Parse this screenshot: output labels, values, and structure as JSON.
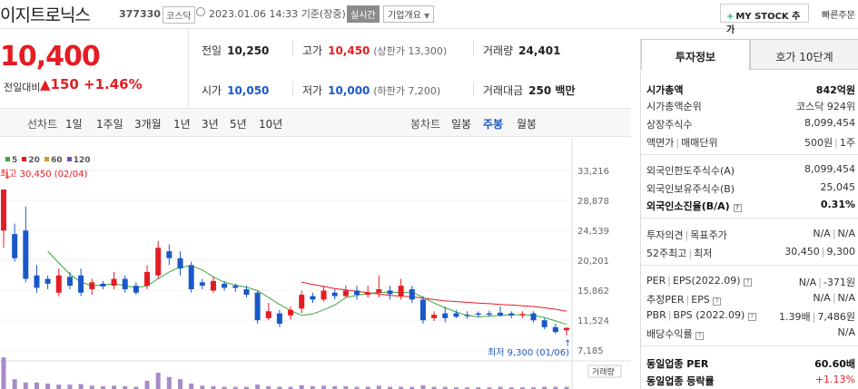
{
  "header": {
    "name": "이지트로닉스",
    "code": "377330",
    "market_badge": "코스닥",
    "datetime": "2023.01.06 14:33",
    "basis": "기준(장중)",
    "realtime_button": "실시간",
    "company_overview": "기업개요",
    "my_stock_button": "MY STOCK 추가",
    "fast_label": "빠른주문"
  },
  "price": {
    "current": "10,400",
    "change_label": "전일대비",
    "change": "▲150",
    "change_pct": "+1.46%"
  },
  "quote": {
    "prev_close_label": "전일",
    "prev_close": "10,250",
    "high_label": "고가",
    "high": "10,450",
    "upper_limit": "(상한가 13,300)",
    "volume_label": "거래량",
    "volume": "24,401",
    "open_label": "시가",
    "open": "10,050",
    "low_label": "저가",
    "low": "10,000",
    "lower_limit": "(하한가 7,200)",
    "amount_label": "거래대금",
    "amount": "250 백만"
  },
  "toolbar": {
    "line_chart_label": "선차트",
    "periods": [
      "1일",
      "1주일",
      "3개월",
      "1년",
      "3년",
      "5년",
      "10년"
    ],
    "candle_chart_label": "봉차트",
    "candle_periods": [
      "일봉",
      "주봉",
      "월봉"
    ],
    "active_candle": "주봉"
  },
  "chart": {
    "ma_legend": [
      "5",
      "20",
      "60",
      "120"
    ],
    "ma_colors": [
      "#3aa83a",
      "#e51c23",
      "#d79a2c",
      "#7b4bb5"
    ],
    "high_annotation": "최고 30,450 (02/04)",
    "low_annotation": "최저 9,300 (01/06)",
    "volume_label": "거래량",
    "y_ticks": [
      "33,216",
      "28,878",
      "24,539",
      "20,201",
      "15,862",
      "11,524",
      "7,185"
    ]
  },
  "chart_data": {
    "type": "candlestick",
    "y_ticks": [
      33216,
      28878,
      24539,
      20201,
      15862,
      11524,
      7185
    ],
    "ylim": [
      7185,
      33216
    ],
    "candles": [
      {
        "o": 24500,
        "c": 30450,
        "h": 30450,
        "l": 22000
      },
      {
        "o": 24000,
        "c": 20500,
        "h": 25500,
        "l": 20000
      },
      {
        "o": 24500,
        "c": 17500,
        "h": 28000,
        "l": 17000
      },
      {
        "o": 18000,
        "c": 16200,
        "h": 19500,
        "l": 15500
      },
      {
        "o": 17500,
        "c": 16800,
        "h": 18000,
        "l": 16000
      },
      {
        "o": 15500,
        "c": 18000,
        "h": 19000,
        "l": 15000
      },
      {
        "o": 17800,
        "c": 16500,
        "h": 18500,
        "l": 16000
      },
      {
        "o": 18000,
        "c": 15500,
        "h": 19000,
        "l": 15000
      },
      {
        "o": 16000,
        "c": 17000,
        "h": 17500,
        "l": 15200
      },
      {
        "o": 16800,
        "c": 16400,
        "h": 17200,
        "l": 16000
      },
      {
        "o": 16500,
        "c": 17500,
        "h": 18500,
        "l": 16000
      },
      {
        "o": 17500,
        "c": 16000,
        "h": 18000,
        "l": 15500
      },
      {
        "o": 16500,
        "c": 15500,
        "h": 17000,
        "l": 15200
      },
      {
        "o": 16500,
        "c": 18500,
        "h": 19500,
        "l": 16000
      },
      {
        "o": 18000,
        "c": 22000,
        "h": 23000,
        "l": 17500
      },
      {
        "o": 21500,
        "c": 20500,
        "h": 22500,
        "l": 19500
      },
      {
        "o": 20500,
        "c": 19000,
        "h": 21500,
        "l": 18000
      },
      {
        "o": 19500,
        "c": 16000,
        "h": 20000,
        "l": 15500
      },
      {
        "o": 17000,
        "c": 16500,
        "h": 17500,
        "l": 16000
      },
      {
        "o": 15800,
        "c": 17200,
        "h": 17800,
        "l": 15500
      },
      {
        "o": 16800,
        "c": 16200,
        "h": 17200,
        "l": 15800
      },
      {
        "o": 16500,
        "c": 16200,
        "h": 16800,
        "l": 15600
      },
      {
        "o": 16000,
        "c": 15200,
        "h": 16500,
        "l": 14800
      },
      {
        "o": 15500,
        "c": 11500,
        "h": 15800,
        "l": 11000
      },
      {
        "o": 11800,
        "c": 12800,
        "h": 14000,
        "l": 11500
      },
      {
        "o": 12500,
        "c": 11000,
        "h": 13000,
        "l": 10500
      },
      {
        "o": 12200,
        "c": 13000,
        "h": 13500,
        "l": 11600
      },
      {
        "o": 13200,
        "c": 15200,
        "h": 15800,
        "l": 12500
      },
      {
        "o": 15000,
        "c": 14500,
        "h": 15500,
        "l": 14000
      },
      {
        "o": 14500,
        "c": 15800,
        "h": 16500,
        "l": 14200
      },
      {
        "o": 15500,
        "c": 15000,
        "h": 16000,
        "l": 14500
      },
      {
        "o": 15000,
        "c": 15800,
        "h": 16500,
        "l": 14800
      },
      {
        "o": 15800,
        "c": 15200,
        "h": 16500,
        "l": 14500
      },
      {
        "o": 15200,
        "c": 15500,
        "h": 16500,
        "l": 14800
      },
      {
        "o": 15500,
        "c": 16000,
        "h": 18000,
        "l": 14800
      },
      {
        "o": 15800,
        "c": 15300,
        "h": 16500,
        "l": 14500
      },
      {
        "o": 15000,
        "c": 16500,
        "h": 17500,
        "l": 14500
      },
      {
        "o": 16000,
        "c": 14500,
        "h": 16500,
        "l": 14000
      },
      {
        "o": 14500,
        "c": 11500,
        "h": 15000,
        "l": 11000
      },
      {
        "o": 11800,
        "c": 12300,
        "h": 12800,
        "l": 11400
      },
      {
        "o": 12500,
        "c": 11800,
        "h": 13500,
        "l": 11200
      },
      {
        "o": 12500,
        "c": 12000,
        "h": 13000,
        "l": 11800
      },
      {
        "o": 12300,
        "c": 12100,
        "h": 12800,
        "l": 11700
      },
      {
        "o": 12500,
        "c": 12300,
        "h": 12800,
        "l": 11900
      },
      {
        "o": 12500,
        "c": 12400,
        "h": 12900,
        "l": 12000
      },
      {
        "o": 12600,
        "c": 12200,
        "h": 13500,
        "l": 12000
      },
      {
        "o": 12500,
        "c": 12200,
        "h": 12800,
        "l": 11800
      },
      {
        "o": 12200,
        "c": 12400,
        "h": 12800,
        "l": 11800
      },
      {
        "o": 12500,
        "c": 11500,
        "h": 12800,
        "l": 11200
      },
      {
        "o": 11500,
        "c": 10500,
        "h": 11800,
        "l": 10200
      },
      {
        "o": 10500,
        "c": 9800,
        "h": 11000,
        "l": 9500
      },
      {
        "o": 10050,
        "c": 10400,
        "h": 10450,
        "l": 9300
      }
    ],
    "ma5": [
      null,
      null,
      null,
      null,
      21500,
      19800,
      18200,
      17000,
      16500,
      16600,
      16800,
      16500,
      16200,
      16500,
      17500,
      18500,
      19200,
      19400,
      18800,
      17800,
      17000,
      16600,
      16300,
      15800,
      14800,
      13800,
      12900,
      12200,
      12400,
      13000,
      13700,
      14800,
      15100,
      15400,
      15500,
      15600,
      15500,
      15600,
      14800,
      14000,
      13300,
      12700,
      12200,
      12000,
      12100,
      12200,
      12300,
      12300,
      12200,
      11900,
      11400,
      10900
    ],
    "ma20": [
      null,
      null,
      null,
      null,
      null,
      null,
      null,
      null,
      null,
      null,
      null,
      null,
      null,
      null,
      null,
      null,
      null,
      null,
      null,
      null,
      null,
      null,
      null,
      null,
      null,
      null,
      null,
      17000,
      16700,
      16400,
      16100,
      15900,
      15700,
      15500,
      15300,
      15100,
      15000,
      14900,
      14700,
      14500,
      14300,
      14200,
      14100,
      14000,
      13900,
      13800,
      13700,
      13600,
      13500,
      13300,
      13100,
      12800
    ],
    "volume": [
      0.58,
      0.18,
      0.12,
      0.12,
      0.1,
      0.08,
      0.08,
      0.09,
      0.06,
      0.05,
      0.06,
      0.05,
      0.04,
      0.15,
      0.3,
      0.22,
      0.18,
      0.1,
      0.06,
      0.05,
      0.04,
      0.04,
      0.04,
      0.08,
      0.05,
      0.04,
      0.04,
      0.07,
      0.05,
      0.06,
      0.05,
      0.05,
      0.04,
      0.04,
      0.06,
      0.04,
      0.04,
      0.04,
      0.07,
      0.04,
      0.04,
      0.03,
      0.03,
      0.03,
      0.03,
      0.04,
      0.03,
      0.03,
      0.03,
      0.04,
      0.04,
      0.04
    ]
  },
  "tabs": {
    "invest_info": "투자정보",
    "order_book": "호가 10단계"
  },
  "invest": {
    "market_cap_label": "시가총액",
    "market_cap": "842억원",
    "market_cap_rank_label": "시가총액순위",
    "market_cap_rank": "코스닥 924위",
    "listed_shares_label": "상장주식수",
    "listed_shares": "8,099,454",
    "face_value_label": "액면가",
    "trade_unit_label": "매매단위",
    "face_value": "500원",
    "trade_unit": "1주",
    "foreign_limit_label": "외국인한도주식수(A)",
    "foreign_limit": "8,099,454",
    "foreign_hold_label": "외국인보유주식수(B)",
    "foreign_hold": "25,045",
    "foreign_ratio_label": "외국인소진율(B/A)",
    "foreign_ratio": "0.31%",
    "opinion_label": "투자의견",
    "target_label": "목표주가",
    "opinion": "N/A",
    "target": "N/A",
    "week52_high_label": "52주최고",
    "week52_low_label": "최저",
    "week52_high": "30,450",
    "week52_low": "9,300",
    "per_label": "PER",
    "eps_label": "EPS(2022.09)",
    "per": "N/A",
    "eps": "-371원",
    "est_per_label": "추정PER",
    "est_eps_label": "EPS",
    "est_per": "N/A",
    "est_eps": "N/A",
    "pbr_label": "PBR",
    "bps_label": "BPS (2022.09)",
    "pbr": "1.39배",
    "bps": "7,486원",
    "div_label": "배당수익률",
    "div": "N/A",
    "sector_per_label": "동일업종 PER",
    "sector_per": "60.60배",
    "sector_change_label": "동일업종 등락률",
    "sector_change": "+1.13%"
  }
}
